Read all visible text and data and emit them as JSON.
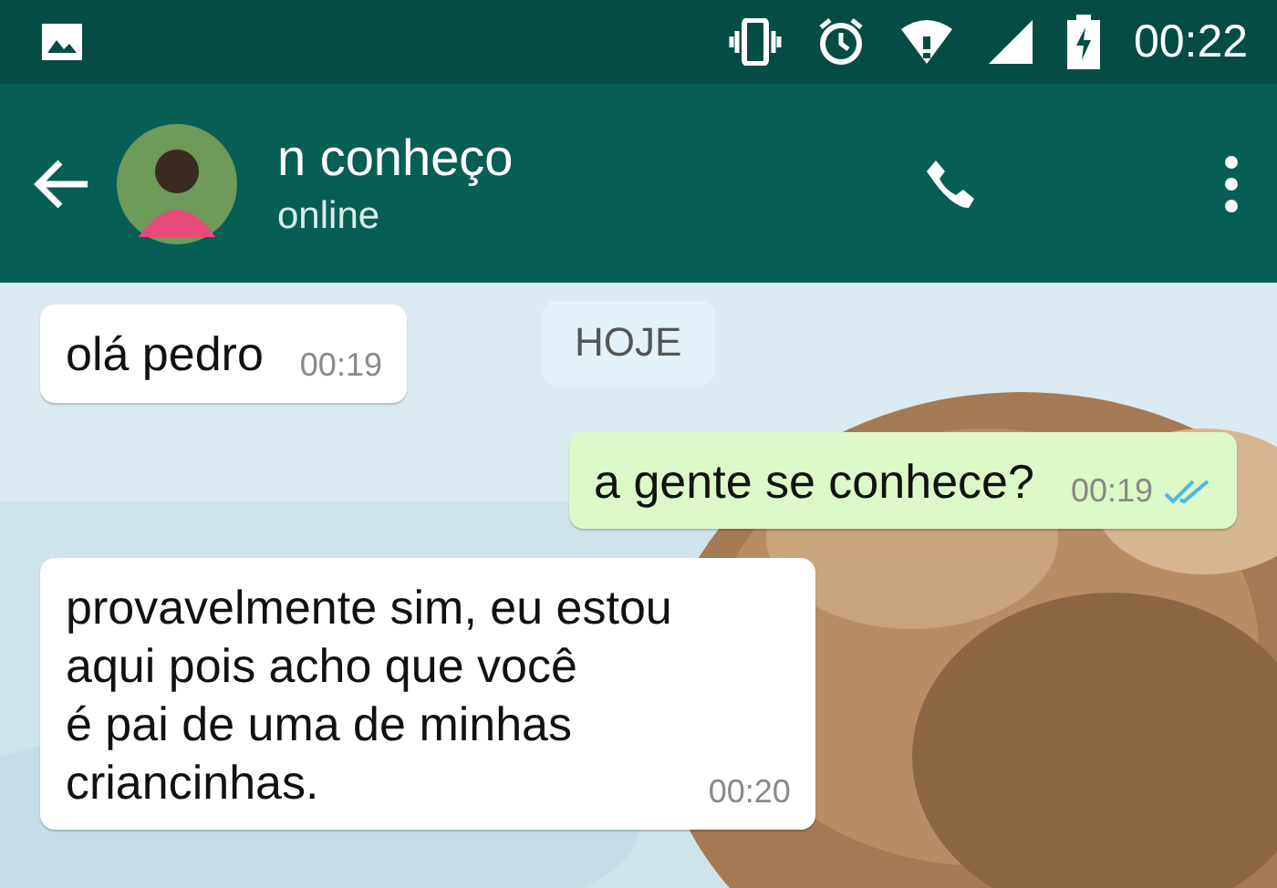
{
  "status_bar": {
    "time": "00:22"
  },
  "header": {
    "name": "n conheço",
    "status": "online"
  },
  "date_chip": "HOJE",
  "messages": [
    {
      "kind": "in",
      "text": "olá pedro",
      "time": "00:19"
    },
    {
      "kind": "out",
      "text": "a gente se conhece?",
      "time": "00:19",
      "read": true
    },
    {
      "kind": "in",
      "text": "provavelmente sim, eu estou\naqui pois acho que você\né pai de uma de minhas\ncriancinhas.",
      "time": "00:20"
    }
  ]
}
